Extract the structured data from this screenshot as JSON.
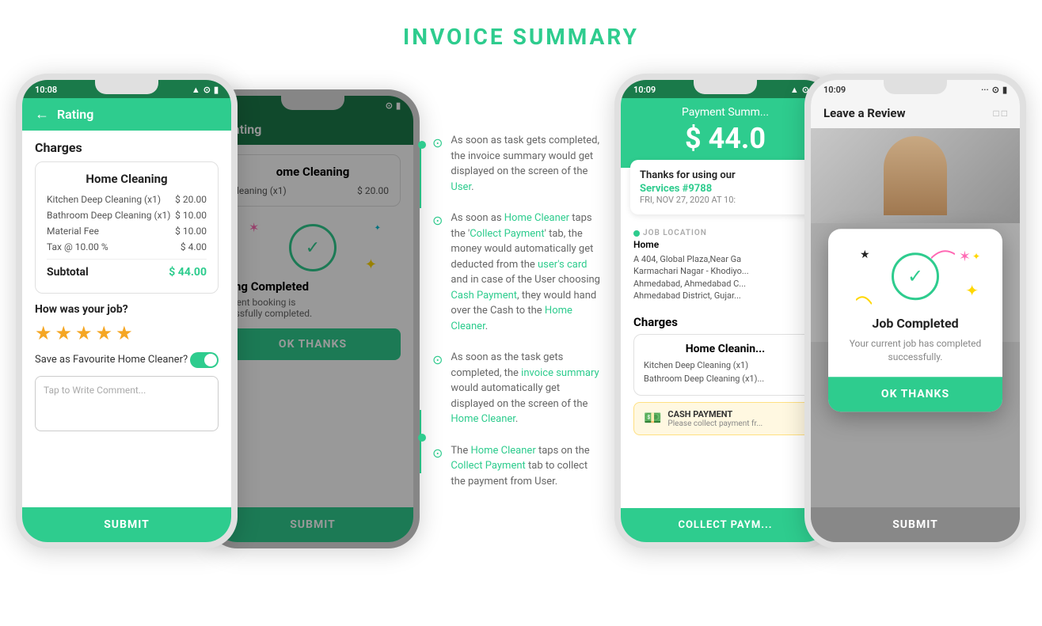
{
  "page": {
    "title": "INVOICE SUMMARY"
  },
  "phone1": {
    "status_time": "10:08",
    "header_title": "Rating",
    "charges_title": "Charges",
    "service_title": "Home Cleaning",
    "items": [
      {
        "name": "Kitchen Deep Cleaning (x1)",
        "amount": "$ 20.00"
      },
      {
        "name": "Bathroom Deep Cleaning (x1)",
        "amount": "$ 10.00"
      },
      {
        "name": "Material Fee",
        "amount": "$ 10.00"
      },
      {
        "name": "Tax @ 10.00 %",
        "amount": "$ 4.00"
      }
    ],
    "subtotal_label": "Subtotal",
    "subtotal_amount": "$ 44.00",
    "rating_label": "How was your job?",
    "fav_label": "Save as Favourite Home Cleaner?",
    "comment_placeholder": "Tap to Write Comment...",
    "submit_label": "SUBMIT"
  },
  "phone2": {
    "status_time": "...",
    "header_title": "Rating",
    "service_title": "ome Cleaning",
    "item1_amount": "$ 20.00",
    "booking_status": "king Completed",
    "booking_sub": "urrent booking is\ncessfully completed.",
    "ok_thanks": "OK THANKS",
    "submit_label": "SUBMIT"
  },
  "descriptions": [
    {
      "icon": "✓",
      "text": "As soon as task gets completed, the invoice summary would get displayed on the screen of the User."
    },
    {
      "icon": "✓",
      "text": "As soon as Home Cleaner taps the 'Collect Payment' tab, the money would automatically get deducted from the user's card and in case of the User choosing Cash Payment, they would hand over the Cash to the Home Cleaner."
    },
    {
      "icon": "✓",
      "text": "As soon as the task gets completed, the invoice summary would automatically get displayed on the screen of the Home Cleaner."
    },
    {
      "icon": "✓",
      "text": "The Home Cleaner taps on the Collect Payment tab to collect the payment from User."
    }
  ],
  "phone3": {
    "status_time": "10:09",
    "header_title": "Payment Summ...",
    "payment_amount": "$ 44.0",
    "thanks_text": "Thanks for using our",
    "service_num": "Services #9788",
    "date_text": "FRI, NOV 27, 2020 AT 10:",
    "location_label": "JOB LOCATION",
    "location_name": "Home",
    "location_address": "A 404, Global Plaza,Near Ga\nKarmachari Nagar - Khodiyo...\nAhmedabad, Ahmedabad C...\nAhmedabad District, Gujar...",
    "charges_title": "Charges",
    "service_title2": "Home Cleanin...",
    "item1": "Kitchen Deep Cleaning (x1)",
    "item2": "Bathroom Deep Cleaning (x1)...",
    "cash_label": "CASH PAYMENT",
    "cash_sub": "Please collect payment fr...",
    "collect_btn": "COLLECT PAYM..."
  },
  "phone4": {
    "status_time": "10:09",
    "header_title": "Leave a Review",
    "popup_title": "Job Completed",
    "popup_desc": "Your current job has completed successfully.",
    "ok_thanks": "OK THANKS",
    "submit_label": "SUBMIT"
  }
}
